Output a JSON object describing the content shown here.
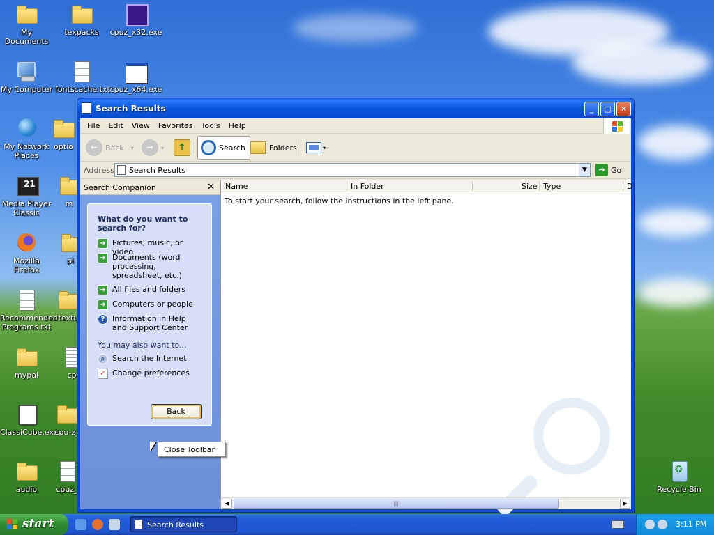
{
  "desktop": {
    "icons": [
      {
        "label": "My Documents",
        "icon": "my-documents-icon"
      },
      {
        "label": "texpacks",
        "icon": "folder-icon"
      },
      {
        "label": "cpuz_x32.exe",
        "icon": "cpuz-icon"
      },
      {
        "label": "My Computer",
        "icon": "computer-icon"
      },
      {
        "label": "fontscache.txt",
        "icon": "text-file-icon"
      },
      {
        "label": "cpuz_x64.exe",
        "icon": "app-window-icon"
      },
      {
        "label": "My Network Places",
        "icon": "network-icon"
      },
      {
        "label": "optio",
        "icon": "folder-icon"
      },
      {
        "label": "Media Player Classic",
        "icon": "media-player-icon"
      },
      {
        "label": "m",
        "icon": "folder-icon"
      },
      {
        "label": "Mozilla Firefox",
        "icon": "firefox-icon"
      },
      {
        "label": "pi",
        "icon": "folder-icon"
      },
      {
        "label": "Recommended Programs.txt",
        "icon": "text-file-icon"
      },
      {
        "label": "textu",
        "icon": "folder-icon"
      },
      {
        "label": "mypal",
        "icon": "folder-icon"
      },
      {
        "label": "cp",
        "icon": "file-icon"
      },
      {
        "label": "ClassiCube.exe",
        "icon": "classicube-icon"
      },
      {
        "label": "cpu-z_",
        "icon": "folder-icon"
      },
      {
        "label": "audio",
        "icon": "folder-icon"
      },
      {
        "label": "cpuz_",
        "icon": "file-icon"
      },
      {
        "label": "Recycle Bin",
        "icon": "recycle-bin-icon"
      }
    ]
  },
  "window": {
    "title": "Search Results",
    "menu": [
      "File",
      "Edit",
      "View",
      "Favorites",
      "Tools",
      "Help"
    ],
    "toolbar": {
      "back": "Back",
      "search": "Search",
      "folders": "Folders"
    },
    "address": {
      "label": "Address",
      "value": "Search Results",
      "go": "Go"
    },
    "search_companion": {
      "title": "Search Companion",
      "close": "✕",
      "question": "What do you want to search for?",
      "options": [
        "Pictures, music, or video",
        "Documents (word processing, spreadsheet, etc.)",
        "All files and folders",
        "Computers or people",
        "Information in Help and Support Center"
      ],
      "also_heading": "You may also want to...",
      "also": [
        "Search the Internet",
        "Change preferences"
      ],
      "back_button": "Back"
    },
    "results": {
      "columns": [
        "Name",
        "In Folder",
        "Size",
        "Type",
        "D"
      ],
      "message": "To start your search, follow the instructions in the left pane."
    }
  },
  "context_menu": {
    "item": "Close Toolbar"
  },
  "taskbar": {
    "start": "start",
    "task": "Search Results",
    "clock": "3:11 PM"
  },
  "colors": {
    "titlebar": "#0a58e0",
    "taskbar": "#245edb",
    "start": "#2d8a2d",
    "panel": "#d6dff7"
  }
}
